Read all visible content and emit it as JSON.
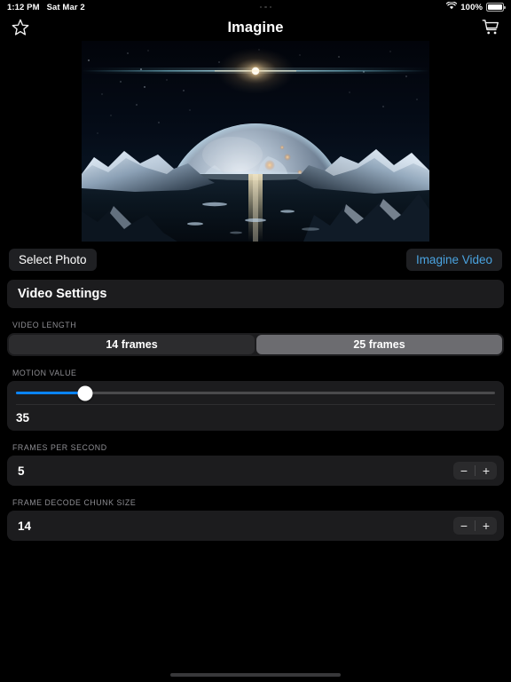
{
  "status_bar": {
    "time": "1:12 PM",
    "date": "Sat Mar 2",
    "battery_percent": "100%",
    "wifi_icon": "wifi-icon",
    "battery_icon": "battery-icon",
    "multitask_icon": "three-dots-icon"
  },
  "nav": {
    "title": "Imagine",
    "left_icon": "star-outline-icon",
    "right_icon": "shopping-cart-icon"
  },
  "hero": {
    "name": "generated-space-scene-image",
    "description": "Icy planet rising over a frozen reflective lake with a bright sun"
  },
  "actions": {
    "select_photo": "Select Photo",
    "imagine_video": "Imagine Video",
    "accent_color": "#4aa3e0"
  },
  "settings": {
    "section_title": "Video Settings",
    "video_length": {
      "label": "VIDEO LENGTH",
      "options": [
        "14 frames",
        "25 frames"
      ],
      "selected_index": 1
    },
    "motion_value": {
      "label": "MOTION VALUE",
      "value": "35",
      "percent": 14.5,
      "fill_color": "#0a84ff"
    },
    "frames_per_second": {
      "label": "FRAMES PER SECOND",
      "value": "5",
      "decrement": "−",
      "increment": "+"
    },
    "frame_decode_chunk_size": {
      "label": "FRAME DECODE CHUNK SIZE",
      "value": "14",
      "decrement": "−",
      "increment": "+"
    }
  }
}
